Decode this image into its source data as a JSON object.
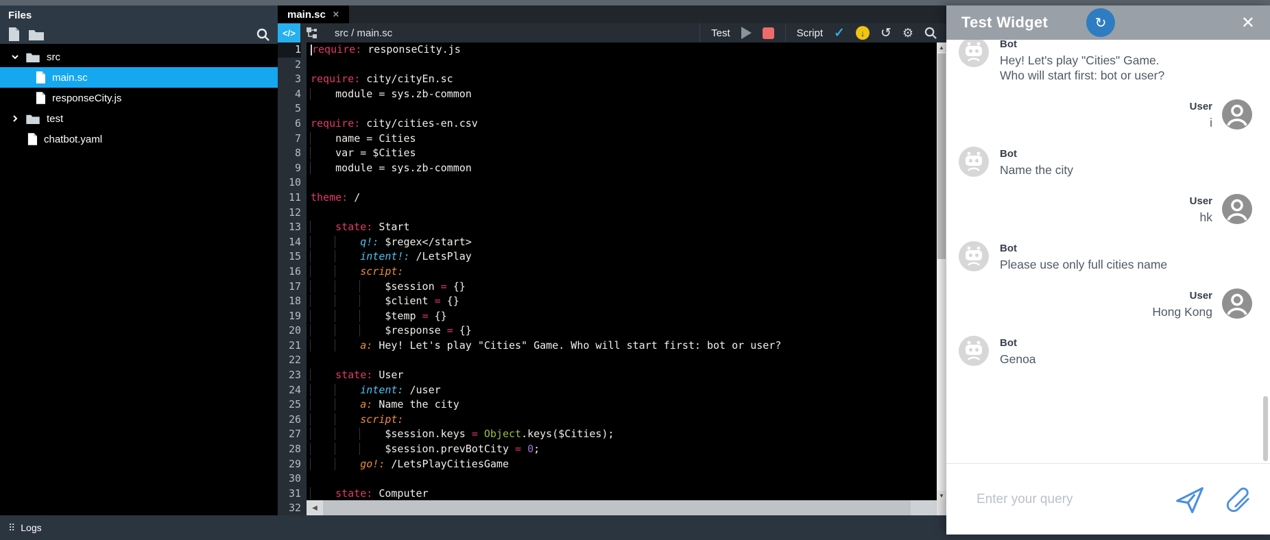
{
  "files_panel": {
    "title": "Files",
    "tree": [
      {
        "label": "src",
        "type": "folder",
        "level": 0,
        "expanded": true,
        "selected": false
      },
      {
        "label": "main.sc",
        "type": "file",
        "level": 1,
        "selected": true
      },
      {
        "label": "responseCity.js",
        "type": "file",
        "level": 1,
        "selected": false
      },
      {
        "label": "test",
        "type": "folder",
        "level": 0,
        "expanded": false,
        "selected": false
      },
      {
        "label": "chatbot.yaml",
        "type": "file",
        "level": 0,
        "selected": false
      }
    ]
  },
  "tabs": [
    {
      "label": "main.sc",
      "active": true
    }
  ],
  "toolbar": {
    "breadcrumb": "src / main.sc",
    "test_label": "Test",
    "script_label": "Script",
    "deploy_glyph": "↓",
    "undo_glyph": "↺",
    "gear_glyph": "⚙",
    "check_glyph": "✓"
  },
  "editor": {
    "line_count": 32,
    "active_line": 1,
    "caret_line": 1,
    "lines": [
      [
        [
          "require:",
          "k"
        ],
        [
          " responseCity.js",
          "p"
        ]
      ],
      [],
      [
        [
          "require:",
          "k"
        ],
        [
          " city/cityEn.sc",
          "p"
        ]
      ],
      [
        [
          "    module = sys.zb-common",
          "p"
        ]
      ],
      [],
      [
        [
          "require:",
          "k"
        ],
        [
          " city/cities-en.csv",
          "p"
        ]
      ],
      [
        [
          "    name = Cities",
          "p"
        ]
      ],
      [
        [
          "    var = $Cities",
          "p"
        ]
      ],
      [
        [
          "    module = sys.zb-common",
          "p"
        ]
      ],
      [],
      [
        [
          "theme:",
          "k"
        ],
        [
          " /",
          "p"
        ]
      ],
      [],
      [
        [
          "    ",
          "p"
        ],
        [
          "state:",
          "k"
        ],
        [
          " Start",
          "p"
        ]
      ],
      [
        [
          "        ",
          "p"
        ],
        [
          "q!:",
          "c"
        ],
        [
          " $regex</start>",
          "p"
        ]
      ],
      [
        [
          "        ",
          "p"
        ],
        [
          "intent!:",
          "c"
        ],
        [
          " /LetsPlay",
          "p"
        ]
      ],
      [
        [
          "        ",
          "p"
        ],
        [
          "script:",
          "o"
        ]
      ],
      [
        [
          "            $session ",
          "p"
        ],
        [
          "=",
          "e"
        ],
        [
          " {}",
          "p"
        ]
      ],
      [
        [
          "            $client ",
          "p"
        ],
        [
          "=",
          "e"
        ],
        [
          " {}",
          "p"
        ]
      ],
      [
        [
          "            $temp ",
          "p"
        ],
        [
          "=",
          "e"
        ],
        [
          " {}",
          "p"
        ]
      ],
      [
        [
          "            $response ",
          "p"
        ],
        [
          "=",
          "e"
        ],
        [
          " {}",
          "p"
        ]
      ],
      [
        [
          "        ",
          "p"
        ],
        [
          "a:",
          "o"
        ],
        [
          " Hey! Let's play \"Cities\" Game. Who will start first: bot or user?",
          "p"
        ]
      ],
      [],
      [
        [
          "    ",
          "p"
        ],
        [
          "state:",
          "k"
        ],
        [
          " User",
          "p"
        ]
      ],
      [
        [
          "        ",
          "p"
        ],
        [
          "intent:",
          "c"
        ],
        [
          " /user",
          "p"
        ]
      ],
      [
        [
          "        ",
          "p"
        ],
        [
          "a:",
          "o"
        ],
        [
          " Name the city",
          "p"
        ]
      ],
      [
        [
          "        ",
          "p"
        ],
        [
          "script:",
          "o"
        ]
      ],
      [
        [
          "            $session.keys ",
          "p"
        ],
        [
          "=",
          "e"
        ],
        [
          " ",
          "p"
        ],
        [
          "Object",
          "g"
        ],
        [
          ".keys($Cities);",
          "p"
        ]
      ],
      [
        [
          "            $session.prevBotCity ",
          "p"
        ],
        [
          "=",
          "e"
        ],
        [
          " ",
          "p"
        ],
        [
          "0",
          "u"
        ],
        [
          ";",
          "p"
        ]
      ],
      [
        [
          "        ",
          "p"
        ],
        [
          "go!:",
          "o"
        ],
        [
          " /LetsPlayCitiesGame",
          "p"
        ]
      ],
      [],
      [
        [
          "    ",
          "p"
        ],
        [
          "state:",
          "k"
        ],
        [
          " Computer",
          "p"
        ]
      ]
    ]
  },
  "logs": {
    "label": "Logs"
  },
  "widget": {
    "title": "Test Widget",
    "messages": [
      {
        "role": "bot",
        "label": "Bot",
        "text": "Hey! Let's play \"Cities\" Game. Who will start first: bot or user?"
      },
      {
        "role": "user",
        "label": "User",
        "text": "i"
      },
      {
        "role": "bot",
        "label": "Bot",
        "text": "Name the city"
      },
      {
        "role": "user",
        "label": "User",
        "text": "hk"
      },
      {
        "role": "bot",
        "label": "Bot",
        "text": "Please use only full cities name"
      },
      {
        "role": "user",
        "label": "User",
        "text": "Hong Kong"
      },
      {
        "role": "bot",
        "label": "Bot",
        "text": "Genoa"
      }
    ],
    "input_placeholder": "Enter your query"
  }
}
